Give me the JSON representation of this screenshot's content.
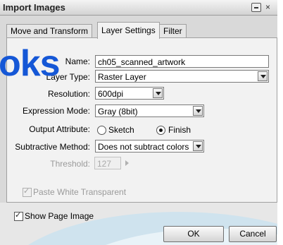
{
  "dialog": {
    "title": "Import Images",
    "close_glyph": "×"
  },
  "tabs": [
    {
      "label": "Move and Transform",
      "active": false
    },
    {
      "label": "Layer Settings",
      "active": true
    },
    {
      "label": "Filter",
      "active": false
    }
  ],
  "watermark": {
    "text": "oks"
  },
  "fields": {
    "layer_name": {
      "label": "Name:",
      "value": "ch05_scanned_artwork"
    },
    "layer_type": {
      "label": "Layer Type:",
      "value": "Raster Layer"
    },
    "resolution": {
      "label": "Resolution:",
      "value": "600dpi"
    },
    "expression_mode": {
      "label": "Expression Mode:",
      "value": "Gray (8bit)"
    },
    "output_attribute": {
      "label": "Output Attribute:",
      "option_sketch": "Sketch",
      "option_finish": "Finish",
      "selected": "Finish"
    },
    "subtractive_method": {
      "label": "Subtractive Method:",
      "value": "Does not subtract colors"
    },
    "threshold": {
      "label": "Threshold:",
      "value": "127"
    }
  },
  "paste_white_transparent": {
    "label": "Paste White Transparent",
    "checked": true,
    "disabled": true
  },
  "show_page_image": {
    "label": "Show Page Image",
    "checked": true
  },
  "buttons": {
    "ok": "OK",
    "cancel": "Cancel"
  }
}
